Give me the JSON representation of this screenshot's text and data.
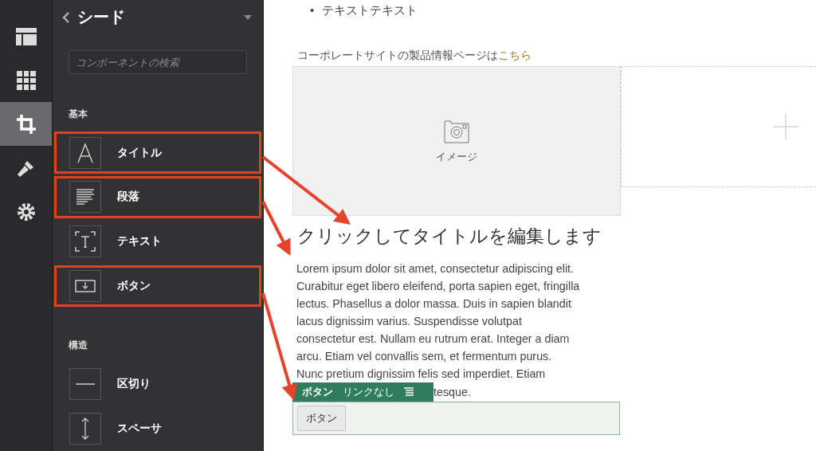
{
  "icon_rail": {
    "items": [
      {
        "selected": false
      },
      {
        "selected": false
      },
      {
        "selected": true
      },
      {
        "selected": false
      },
      {
        "selected": false
      }
    ]
  },
  "panel": {
    "title": "シード",
    "search": {
      "placeholder": "コンポーネントの検索"
    },
    "sections": [
      {
        "heading": "基本",
        "items": [
          {
            "label": "タイトル",
            "highlighted": true
          },
          {
            "label": "段落",
            "highlighted": true
          },
          {
            "label": "テキスト",
            "highlighted": false
          },
          {
            "label": "ボタン",
            "highlighted": true
          }
        ]
      },
      {
        "heading": "構造",
        "items": [
          {
            "label": "区切り",
            "highlighted": false
          },
          {
            "label": "スペーサ",
            "highlighted": false
          }
        ]
      }
    ]
  },
  "page": {
    "bullets": [
      {
        "marker": "•",
        "text": "テキストテキスト"
      }
    ],
    "link_line": {
      "text": "コーポレートサイトの製品情報ページは",
      "link": "こちら"
    },
    "image_placeholder": {
      "label": "イメージ"
    },
    "title": "クリックしてタイトルを編集します",
    "paragraph": [
      "Lorem ipsum dolor sit amet, consectetur adipiscing elit.",
      "Curabitur eget libero eleifend, porta sapien eget, fringilla",
      "lectus. Phasellus a dolor massa. Duis in sapien blandit",
      "lacus dignissim varius. Suspendisse volutpat",
      "consectetur est. Nullam eu rutrum erat. Integer a diam",
      "arcu. Etiam vel convallis sem, et fermentum purus.",
      "Nunc pretium dignissim felis sed imperdiet. Etiam"
    ],
    "paragraph_tail": "tesque.",
    "button_toolbar": {
      "type_label": "ボタン",
      "link_label": "リンクなし"
    },
    "button_label": "ボタン"
  }
}
